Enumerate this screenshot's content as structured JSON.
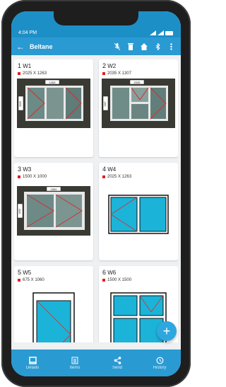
{
  "status": {
    "time": "4:04 PM"
  },
  "appbar": {
    "title": "Beltane"
  },
  "cards": [
    {
      "num": "1",
      "name": "W1",
      "size": "2025 X 1263",
      "top_measure": "1263",
      "side_measure": "2025"
    },
    {
      "num": "2",
      "name": "W2",
      "size": "2035 X 1307",
      "top_measure": "2035",
      "side_measure": "1307"
    },
    {
      "num": "3",
      "name": "W3",
      "size": "1500 X 1000",
      "top_measure": "1500",
      "side_measure": "1000"
    },
    {
      "num": "4",
      "name": "W4",
      "size": "2025 X 1263"
    },
    {
      "num": "5",
      "name": "W5",
      "size": "675 X 1060"
    },
    {
      "num": "6",
      "name": "W6",
      "size": "1500 X 1500"
    }
  ],
  "fab": {
    "label": "+"
  },
  "nav": [
    {
      "label": "Details",
      "icon": "details-icon"
    },
    {
      "label": "Items",
      "icon": "items-icon"
    },
    {
      "label": "Send",
      "icon": "share-icon"
    },
    {
      "label": "History",
      "icon": "history-icon"
    }
  ],
  "colors": {
    "primary": "#2a9ad3",
    "accent": "#e02020",
    "glass": "#1bb4d8"
  }
}
